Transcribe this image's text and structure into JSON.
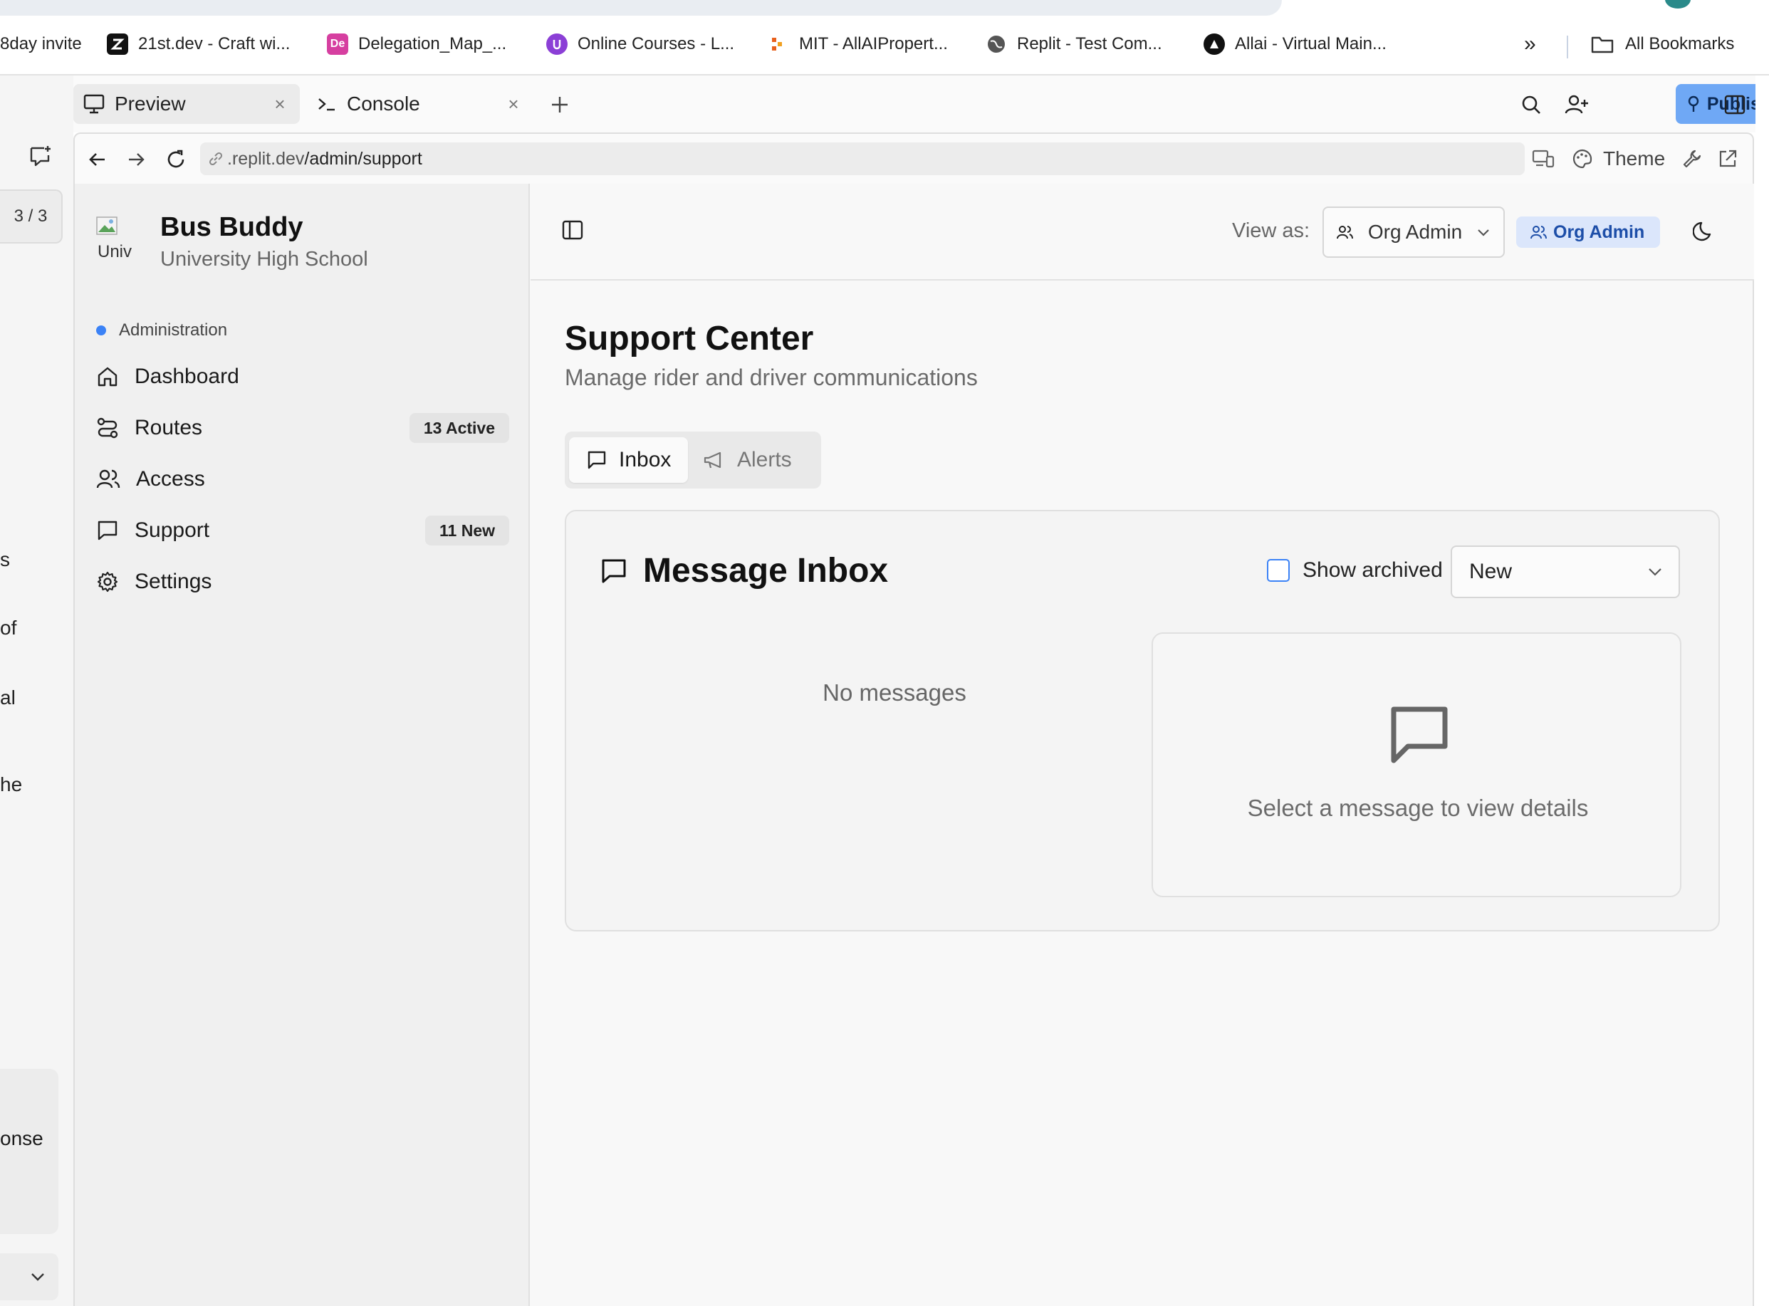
{
  "bookmarks": [
    {
      "label": "8day invite",
      "icon": "none"
    },
    {
      "label": "21st.dev - Craft wi...",
      "icon": "21st-logo-icon",
      "color": "#111111"
    },
    {
      "label": "Delegation_Map_...",
      "icon": "de-logo-icon",
      "color": "#d63fa0",
      "glyph": "De"
    },
    {
      "label": "Online Courses - L...",
      "icon": "online-courses-icon",
      "color": "#8b3fd6"
    },
    {
      "label": "MIT - AllAIPropert...",
      "icon": "mit-grid-icon",
      "color": "#e8601c"
    },
    {
      "label": "Replit - Test Com...",
      "icon": "globe-icon",
      "color": "#555555"
    },
    {
      "label": "Allai - Virtual Main...",
      "icon": "allai-logo-icon",
      "color": "#111111"
    }
  ],
  "bookmarks_more": "»",
  "all_bookmarks": "All Bookmarks",
  "replit": {
    "tabs": [
      {
        "label": "Preview",
        "icon": "monitor-icon",
        "active": true
      },
      {
        "label": "Console",
        "icon": "terminal-icon",
        "active": false
      }
    ],
    "publish_label": "Publish",
    "theme_label": "Theme",
    "url_prefix": ".replit.dev",
    "url_path": "/admin/support",
    "counter": "3 / 3",
    "left_fragments": [
      "s",
      "of",
      "al",
      "he",
      "onse"
    ]
  },
  "app": {
    "brand": {
      "title": "Bus Buddy",
      "subtitle": "University High School",
      "img_alt": "Univ"
    },
    "group_label": "Administration",
    "nav": [
      {
        "label": "Dashboard",
        "icon": "home-icon",
        "badge": ""
      },
      {
        "label": "Routes",
        "icon": "route-icon",
        "badge": "13 Active"
      },
      {
        "label": "Access",
        "icon": "users-icon",
        "badge": ""
      },
      {
        "label": "Support",
        "icon": "message-icon",
        "badge": "11 New"
      },
      {
        "label": "Settings",
        "icon": "gear-icon",
        "badge": ""
      }
    ],
    "topbar": {
      "view_as_label": "View as:",
      "view_as_value": "Org Admin",
      "role_badge": "Org Admin"
    },
    "page": {
      "title": "Support Center",
      "subtitle": "Manage rider and driver communications",
      "tabs": [
        {
          "label": "Inbox",
          "active": true
        },
        {
          "label": "Alerts",
          "active": false
        }
      ]
    },
    "inbox": {
      "title": "Message Inbox",
      "show_archived_label": "Show archived",
      "show_archived": false,
      "status_filter": "New",
      "empty_text": "No messages",
      "detail_hint": "Select a message to view details"
    }
  },
  "colors": {
    "accent": "#3b82f6",
    "publish": "#6fa8f5",
    "role_badge_bg": "#dbe6fb",
    "role_badge_text": "#1d4ea8"
  }
}
